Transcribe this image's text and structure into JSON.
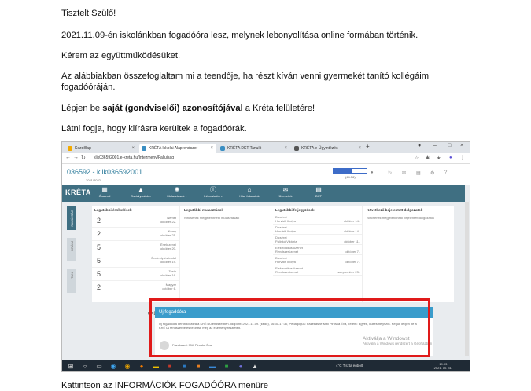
{
  "doc": {
    "greeting": "Tisztelt Szülő!",
    "line1": "2021.11.09-én iskolánkban fogadóóra lesz, melynek lebonyolítása online formában történik.",
    "line2": "Kérem az együttműködésüket.",
    "line3": "Az alábbiakban összefoglaltam mi a teendője, ha részt kíván venni gyermekét tanító kollégáim fogadóóráján.",
    "line4_pre": "Lépjen be ",
    "line4_bold": "saját (gondviselői) azonosítójával",
    "line4_post": " a Kréta felületére!",
    "line5": "Látni fogja, hogy kiírásra kerültek a fogadóórák.",
    "caption": "Kattintson az INFORMÁCIÓK FOGADÓÓRA menüre"
  },
  "browser": {
    "tabs": [
      {
        "label": "Kezdőlap",
        "color": "#f2a900"
      },
      {
        "label": "KRÉTA Iskolai Alaprendszer",
        "color": "#3a8ec2"
      },
      {
        "label": "KRÉTA DKT Tanuló",
        "color": "#3a8ec2"
      },
      {
        "label": "KRÉTA e-Ügyintézés",
        "color": "#555555"
      }
    ],
    "url": "klik036592001.e-kreta.hu/Intezmeny/Faliujsag"
  },
  "kreta": {
    "title": "036592 - klik036592001",
    "year": "2021/2022",
    "session_count": "(44:56)",
    "session_remaining": 0.55,
    "logo": "KRÉTA",
    "menu": [
      {
        "icon": "calendar-icon",
        "glyph": "▦",
        "label": "Órarend"
      },
      {
        "icon": "graduation-icon",
        "glyph": "▲",
        "label": "Osztályzatok ▾"
      },
      {
        "icon": "loader-icon",
        "glyph": "✺",
        "label": "Mulasztások ▾"
      },
      {
        "icon": "info-icon",
        "glyph": "ⓘ",
        "label": "Információk ▾"
      },
      {
        "icon": "home-icon",
        "glyph": "⌂",
        "label": "Házi feladatok"
      },
      {
        "icon": "envelope-icon",
        "glyph": "✉",
        "label": "Üzenetek"
      },
      {
        "icon": "grid-icon",
        "glyph": "▤",
        "label": "DKT"
      }
    ],
    "side_tabs": [
      "FALIÚJSÁG",
      "ÓRÁIM",
      "TAN"
    ],
    "grades_header": "Legutóbbi értékelések",
    "grades": [
      {
        "value": "2",
        "subject": "Német",
        "date": "október 22."
      },
      {
        "value": "2",
        "subject": "Kémy",
        "date": "október 21."
      },
      {
        "value": "5",
        "subject": "Ének-zenei",
        "date": "október 20."
      },
      {
        "value": "5",
        "subject": "Ének-Ny és irodal",
        "date": "október 19."
      },
      {
        "value": "5",
        "subject": "Testn",
        "date": "október 16."
      },
      {
        "value": "2",
        "subject": "Magyar",
        "date": "október 6."
      }
    ],
    "absence_header": "Legutóbbi mulasztások",
    "absence_text": "Nincsenek megjeleníthető mulasztásaik",
    "notes_header": "Legutóbbi feljegyzések",
    "notes": [
      {
        "type": "Dicséret",
        "who": "Horváth Ibolya",
        "date": "október 14."
      },
      {
        "type": "Dicséret",
        "who": "Horváth Ibolya",
        "date": "október 14."
      },
      {
        "type": "Dicséret",
        "who": "Pálinkó Viktória",
        "date": "október 11."
      },
      {
        "type": "Elektronikus üzenet",
        "who": "Rendszerüzenet",
        "date": "október 7."
      },
      {
        "type": "Dicséret",
        "who": "Horváth Ibolya",
        "date": "október 7."
      },
      {
        "type": "Elektronikus üzenet",
        "who": "Rendszerüzenet",
        "date": "szeptember 23."
      }
    ],
    "exams_header": "Következő bejelentett dolgozatok",
    "exams_text": "Nincsenek megjeleníthető bejelentett dolgozatok",
    "event": {
      "year": "2021",
      "date": "okt. 31",
      "title": "Új fogadóóra",
      "body": "Új fogadóóra került kiírásra a KRÉTA rendszerben. Időpont: 2021.11.09. (kedd), 16:30-17:30, Pedagógus: Fazekasné Mitli Piroska Éva, Terem: Egyéb, kültés helyszín. Kérjük lépjen be a KRÉTA rendszerbe és tekintse meg az esemény részleteit.",
      "author": "Fazekasné Mitli Piroska Éva"
    },
    "watermark_title": "Aktiválja a Windowst",
    "watermark_sub": "Aktiválja a Windows rendszert a Gépházban"
  },
  "taskbar": {
    "weather": "4°C  Tiszta égbolt",
    "time": "19:03",
    "date": "2021. 10. 31."
  },
  "colors": {
    "kreta_nav": "#3f6f82",
    "event_header": "#3a9ccb",
    "highlight": "#e01a1a"
  }
}
